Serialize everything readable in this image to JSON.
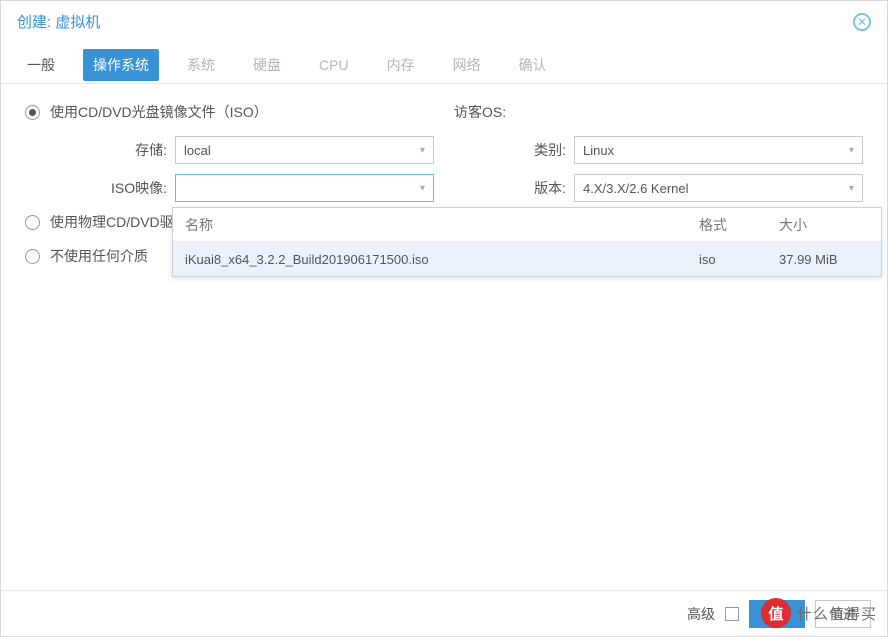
{
  "header": {
    "title": "创建: 虚拟机"
  },
  "tabs": {
    "general": "一般",
    "os": "操作系统",
    "system": "系统",
    "disk": "硬盘",
    "cpu": "CPU",
    "memory": "内存",
    "network": "网络",
    "confirm": "确认"
  },
  "radios": {
    "use_iso": "使用CD/DVD光盘镜像文件（ISO）",
    "use_physical": "使用物理CD/DVD驱动器",
    "use_none": "不使用任何介质"
  },
  "left": {
    "storage_label": "存储:",
    "storage_value": "local",
    "iso_label": "ISO映像:",
    "iso_value": ""
  },
  "right": {
    "guest_label": "访客OS:",
    "type_label": "类别:",
    "type_value": "Linux",
    "version_label": "版本:",
    "version_value": "4.X/3.X/2.6 Kernel"
  },
  "dropdown": {
    "col_name": "名称",
    "col_format": "格式",
    "col_size": "大小",
    "rows": [
      {
        "name": "iKuai8_x64_3.2.2_Build201906171500.iso",
        "format": "iso",
        "size": "37.99 MiB"
      }
    ]
  },
  "footer": {
    "advanced": "高级",
    "back": "返回",
    "next": "前进"
  },
  "watermark": {
    "icon": "值",
    "text": "什么值得买"
  }
}
